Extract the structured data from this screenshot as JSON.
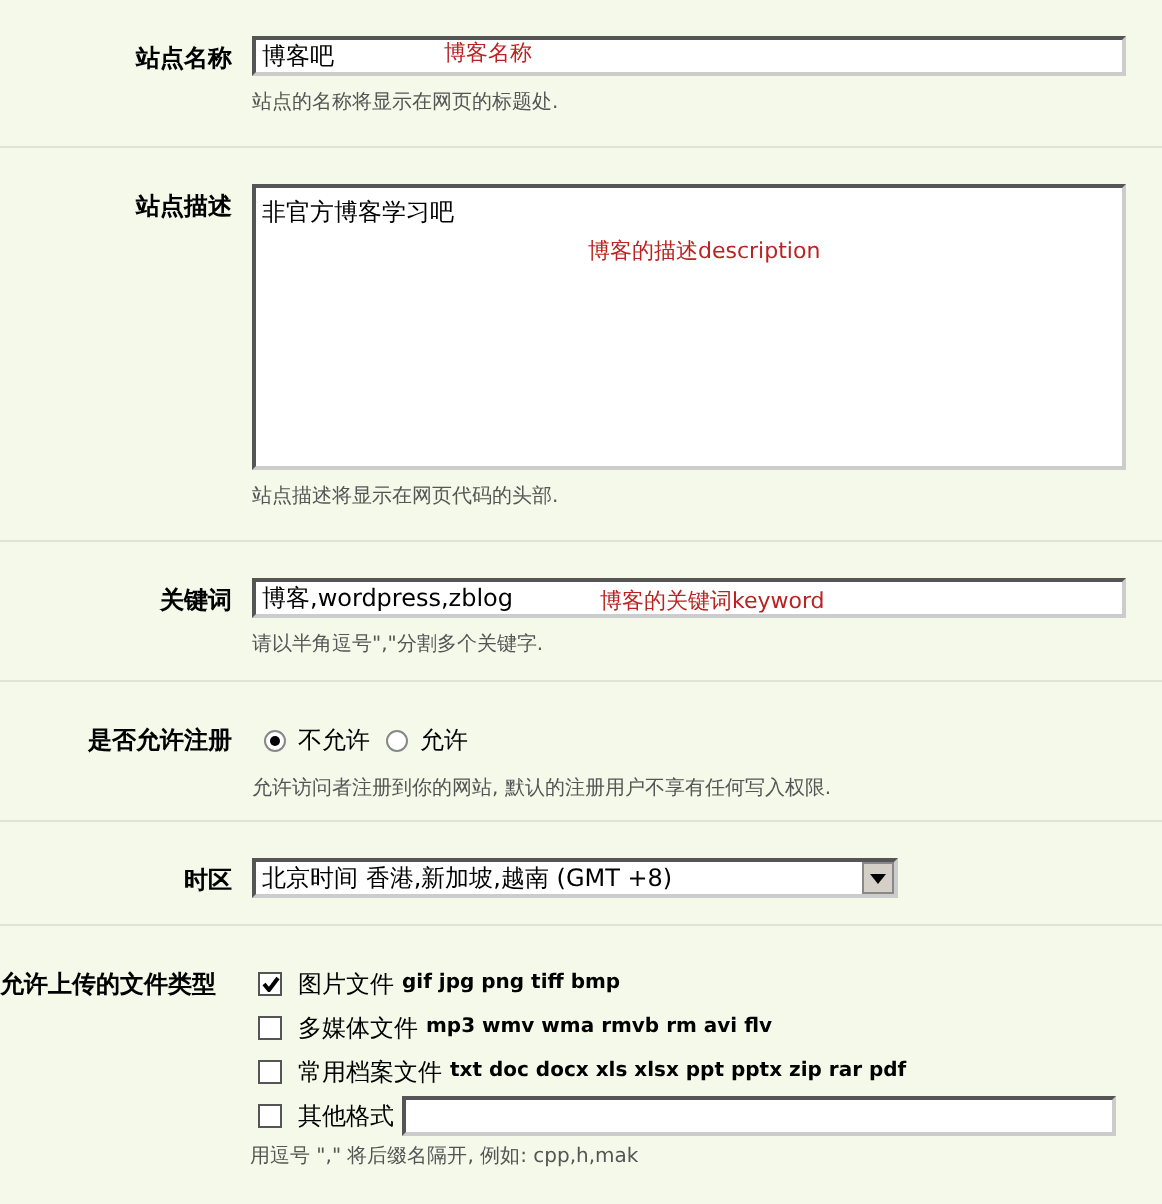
{
  "rows": [
    {
      "kind": "text",
      "label": "站点名称",
      "value": "博客吧",
      "annotation": "博客名称",
      "hint": "站点的名称将显示在网页的标题处."
    },
    {
      "kind": "textarea",
      "label": "站点描述",
      "value": "非官方博客学习吧",
      "annotation": "博客的描述description",
      "hint": "站点描述将显示在网页代码的头部."
    },
    {
      "kind": "text",
      "label": "关键词",
      "value": "博客,wordpress,zblog",
      "annotation": "博客的关键词keyword",
      "hint": "请以半角逗号\",\"分割多个关键字."
    },
    {
      "kind": "radio",
      "label": "是否允许注册",
      "options": [
        {
          "label": "不允许",
          "selected": true
        },
        {
          "label": "允许",
          "selected": false
        }
      ],
      "hint": "允许访问者注册到你的网站, 默认的注册用户不享有任何写入权限."
    },
    {
      "kind": "select",
      "label": "时区",
      "value": "北京时间 香港,新加坡,越南 (GMT +8)"
    },
    {
      "kind": "checklist",
      "label": "允许上传的文件类型",
      "options": [
        {
          "kind": "check",
          "label": "图片文件",
          "extensions": "gif jpg png tiff bmp",
          "checked": true
        },
        {
          "kind": "check",
          "label": "多媒体文件",
          "extensions": "mp3 wmv wma rmvb rm avi flv",
          "checked": false
        },
        {
          "kind": "check",
          "label": "常用档案文件",
          "extensions": "txt doc docx xls xlsx ppt pptx zip rar pdf",
          "checked": false
        },
        {
          "kind": "input",
          "label": "其他格式",
          "checked": false
        }
      ],
      "hint": "用逗号 \",\" 将后缀名隔开, 例如: cpp,h,mak"
    }
  ]
}
